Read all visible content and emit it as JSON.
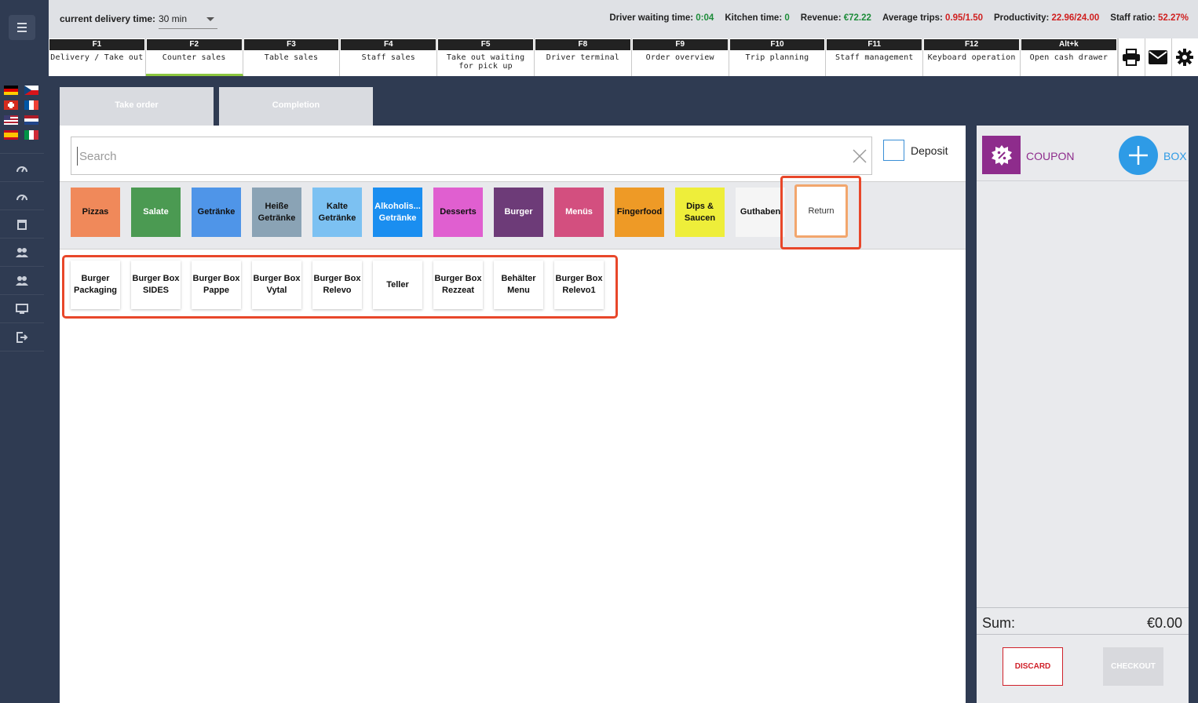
{
  "topbar": {
    "delivery_label": "current delivery time:",
    "delivery_value": "30 min",
    "stats": [
      {
        "label": "Driver waiting time:",
        "value": "0:04",
        "color": "#1e8c3a"
      },
      {
        "label": "Kitchen time:",
        "value": "0",
        "color": "#1e8c3a"
      },
      {
        "label": "Revenue:",
        "value": "€72.22",
        "color": "#1e8c3a"
      },
      {
        "label": "Average trips:",
        "value": "0.95/1.50",
        "color": "#d02020"
      },
      {
        "label": "Productivity:",
        "value": "22.96/24.00",
        "color": "#d02020"
      },
      {
        "label": "Staff ratio:",
        "value": "52.27%",
        "color": "#d02020"
      }
    ]
  },
  "fkeys": [
    {
      "key": "F1",
      "label": "Delivery / Take out"
    },
    {
      "key": "F2",
      "label": "Counter sales"
    },
    {
      "key": "F3",
      "label": "Table sales"
    },
    {
      "key": "F4",
      "label": "Staff sales"
    },
    {
      "key": "F5",
      "label": "Take out waiting for pick up"
    },
    {
      "key": "F8",
      "label": "Driver terminal"
    },
    {
      "key": "F9",
      "label": "Order overview"
    },
    {
      "key": "F10",
      "label": "Trip planning"
    },
    {
      "key": "F11",
      "label": "Staff management"
    },
    {
      "key": "F12",
      "label": "Keyboard operation"
    },
    {
      "key": "Alt+k",
      "label": "Open cash drawer"
    }
  ],
  "tabs": {
    "take_order": "Take order",
    "completion": "Completion"
  },
  "search": {
    "placeholder": "Search"
  },
  "deposit_label": "Deposit",
  "categories": [
    {
      "label": "Pizzas",
      "color": "#f0895a",
      "text": "#111"
    },
    {
      "label": "Salate",
      "color": "#4b9a52",
      "text": "#fff"
    },
    {
      "label": "Getränke",
      "color": "#4f95e8",
      "text": "#111"
    },
    {
      "label": "Heiße Getränke",
      "color": "#8aa3b5",
      "text": "#111"
    },
    {
      "label": "Kalte Getränke",
      "color": "#7cc1f2",
      "text": "#111"
    },
    {
      "label": "Alkoholis... Getränke",
      "color": "#1a8ef0",
      "text": "#fff"
    },
    {
      "label": "Desserts",
      "color": "#e05fd0",
      "text": "#111"
    },
    {
      "label": "Burger",
      "color": "#6d3b78",
      "text": "#fff"
    },
    {
      "label": "Menüs",
      "color": "#d34f7f",
      "text": "#fff"
    },
    {
      "label": "Fingerfood",
      "color": "#ee9a26",
      "text": "#111"
    },
    {
      "label": "Dips & Saucen",
      "color": "#eeee3a",
      "text": "#111"
    },
    {
      "label": "Guthaben",
      "color": "#f5f5f5",
      "text": "#111"
    }
  ],
  "return_label": "Return",
  "products": [
    "Burger Packaging",
    "Burger Box SIDES",
    "Burger Box Pappe",
    "Burger Box Vytal",
    "Burger Box Relevo",
    "Teller",
    "Burger Box Rezzeat",
    "Behälter Menu",
    "Burger Box Relevo1"
  ],
  "cart": {
    "coupon_label": "COUPON",
    "box_label": "BOX",
    "sum_label": "Sum:",
    "sum_value": "€0.00",
    "discard_label": "DISCARD",
    "checkout_label": "CHECKOUT"
  },
  "sidebar": {
    "flags": [
      "germany-flag",
      "czech-flag",
      "swiss-flag",
      "france-flag",
      "usa-flag",
      "netherlands-flag",
      "spain-flag",
      "italy-flag"
    ],
    "nav_icons": [
      "speedometer-icon",
      "speedometer-icon",
      "basket-icon",
      "users-icon",
      "users-icon",
      "monitor-icon",
      "logout-icon"
    ]
  }
}
